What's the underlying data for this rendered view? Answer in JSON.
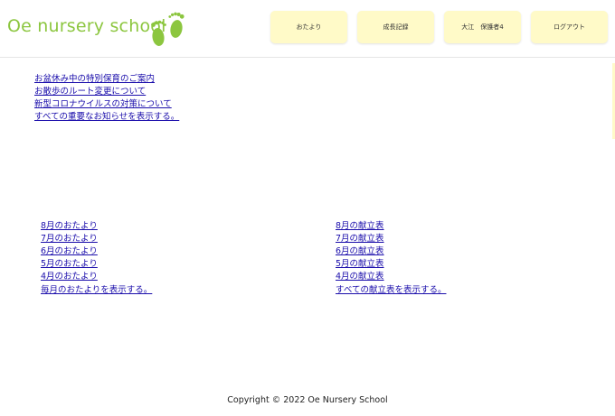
{
  "header": {
    "logo_text": "Oe nursery school",
    "logo_icon": "footprints-icon",
    "brand_color": "#8cc63f",
    "nav": [
      {
        "label": "おたより"
      },
      {
        "label": "成長記録"
      },
      {
        "label": "大江　保護者4"
      },
      {
        "label": "ログアウト"
      }
    ],
    "nav_color": "#fffac8"
  },
  "notices": [
    {
      "label": "お盆休み中の特別保育のご案内"
    },
    {
      "label": "お散歩のルート変更について"
    },
    {
      "label": "新型コロナウイルスの対策について"
    },
    {
      "label": "すべての重要なお知らせを表示する。"
    }
  ],
  "newsletters": [
    {
      "label": "8月のおたより"
    },
    {
      "label": "7月のおたより"
    },
    {
      "label": "6月のおたより"
    },
    {
      "label": "5月のおたより"
    },
    {
      "label": "4月のおたより"
    },
    {
      "label": "毎月のおたよりを表示する。"
    }
  ],
  "menus": [
    {
      "label": "8月の献立表"
    },
    {
      "label": "7月の献立表"
    },
    {
      "label": "6月の献立表"
    },
    {
      "label": "5月の献立表"
    },
    {
      "label": "4月の献立表"
    },
    {
      "label": "すべての献立表を表示する。"
    }
  ],
  "footer": {
    "copyright": "Copyright © 2022 Oe Nursery School"
  }
}
